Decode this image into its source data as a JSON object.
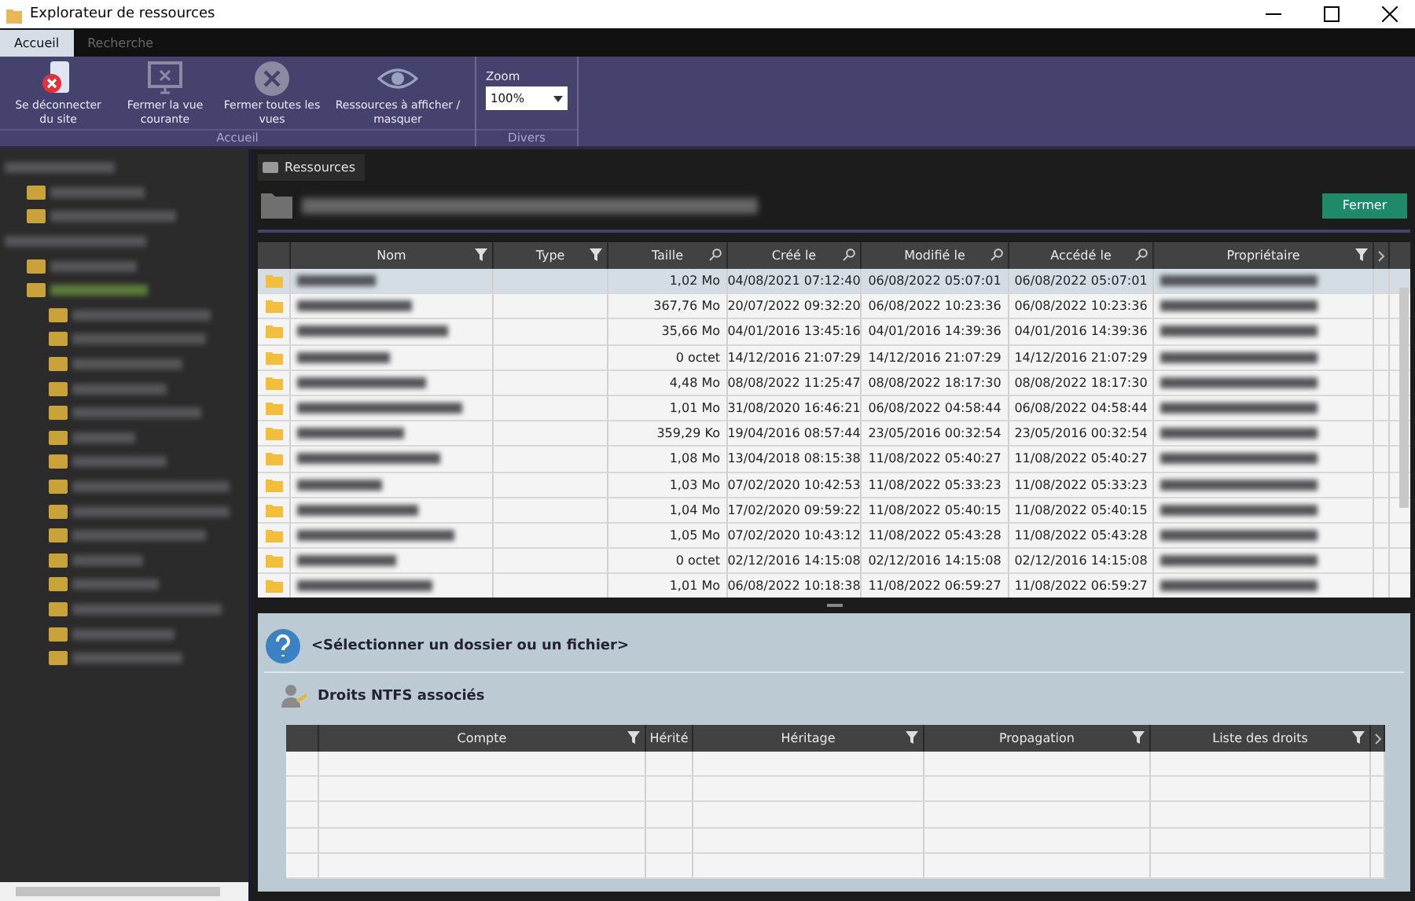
{
  "window": {
    "title": "Explorateur de ressources"
  },
  "ribbon_tabs": [
    {
      "label": "Accueil",
      "selected": true
    },
    {
      "label": "Recherche",
      "selected": false
    }
  ],
  "ribbon_groups": [
    {
      "label": "Accueil",
      "buttons": [
        {
          "kind": "disconnect",
          "label": "Se déconnecter du site"
        },
        {
          "kind": "monitor",
          "label": "Fermer la vue courante"
        },
        {
          "kind": "close-all",
          "label": "Fermer toutes les vues"
        },
        {
          "kind": "eye",
          "label": "Ressources à afficher / masquer"
        }
      ]
    },
    {
      "label": "Divers",
      "zoom": {
        "label": "Zoom",
        "value": "100%"
      }
    }
  ],
  "tree": [
    {
      "selected": false,
      "children": [
        {
          "selected": false
        },
        {
          "selected": false
        }
      ]
    },
    {
      "selected": false,
      "children": [
        {
          "selected": false
        },
        {
          "selected": true,
          "children": [
            {
              "selected": false
            },
            {
              "selected": false
            },
            {
              "selected": false
            },
            {
              "selected": false
            },
            {
              "selected": false
            },
            {
              "selected": false
            },
            {
              "selected": false
            },
            {
              "selected": false
            },
            {
              "selected": false
            },
            {
              "selected": false
            },
            {
              "selected": false
            },
            {
              "selected": false
            },
            {
              "selected": false
            },
            {
              "selected": false
            },
            {
              "selected": false
            }
          ]
        }
      ]
    }
  ],
  "view_tab": {
    "label": "Ressources"
  },
  "close_button": "Fermer",
  "grid": {
    "columns": [
      {
        "label": "Nom",
        "kind": "filter"
      },
      {
        "label": "Type",
        "kind": "filter"
      },
      {
        "label": "Taille",
        "kind": "search"
      },
      {
        "label": "Créé le",
        "kind": "search"
      },
      {
        "label": "Modifié le",
        "kind": "search"
      },
      {
        "label": "Accédé le",
        "kind": "search"
      },
      {
        "label": "Propriétaire",
        "kind": "filter"
      }
    ],
    "rows": [
      {
        "selected": true,
        "size": "1,02 Mo",
        "created": "04/08/2021 07:12:40",
        "modified": "06/08/2022 05:07:01",
        "accessed": "06/08/2022 05:07:01"
      },
      {
        "selected": false,
        "size": "367,76 Mo",
        "created": "20/07/2022 09:32:20",
        "modified": "06/08/2022 10:23:36",
        "accessed": "06/08/2022 10:23:36"
      },
      {
        "selected": false,
        "size": "35,66 Mo",
        "created": "04/01/2016 13:45:16",
        "modified": "04/01/2016 14:39:36",
        "accessed": "04/01/2016 14:39:36"
      },
      {
        "selected": false,
        "size": "0 octet",
        "created": "14/12/2016 21:07:29",
        "modified": "14/12/2016 21:07:29",
        "accessed": "14/12/2016 21:07:29"
      },
      {
        "selected": false,
        "size": "4,48 Mo",
        "created": "08/08/2022 11:25:47",
        "modified": "08/08/2022 18:17:30",
        "accessed": "08/08/2022 18:17:30"
      },
      {
        "selected": false,
        "size": "1,01 Mo",
        "created": "31/08/2020 16:46:21",
        "modified": "06/08/2022 04:58:44",
        "accessed": "06/08/2022 04:58:44"
      },
      {
        "selected": false,
        "size": "359,29 Ko",
        "created": "19/04/2016 08:57:44",
        "modified": "23/05/2016 00:32:54",
        "accessed": "23/05/2016 00:32:54"
      },
      {
        "selected": false,
        "size": "1,08 Mo",
        "created": "13/04/2018 08:15:38",
        "modified": "11/08/2022 05:40:27",
        "accessed": "11/08/2022 05:40:27"
      },
      {
        "selected": false,
        "size": "1,03 Mo",
        "created": "07/02/2020 10:42:53",
        "modified": "11/08/2022 05:33:23",
        "accessed": "11/08/2022 05:33:23"
      },
      {
        "selected": false,
        "size": "1,04 Mo",
        "created": "17/02/2020 09:59:22",
        "modified": "11/08/2022 05:40:15",
        "accessed": "11/08/2022 05:40:15"
      },
      {
        "selected": false,
        "size": "1,05 Mo",
        "created": "07/02/2020 10:43:12",
        "modified": "11/08/2022 05:43:28",
        "accessed": "11/08/2022 05:43:28"
      },
      {
        "selected": false,
        "size": "0 octet",
        "created": "02/12/2016 14:15:08",
        "modified": "02/12/2016 14:15:08",
        "accessed": "02/12/2016 14:15:08"
      },
      {
        "selected": false,
        "size": "1,01 Mo",
        "created": "06/08/2022 10:18:38",
        "modified": "11/08/2022 06:59:27",
        "accessed": "11/08/2022 06:59:27"
      }
    ]
  },
  "details": {
    "prompt": "<Sélectionner un dossier ou un fichier>",
    "rights_title": "Droits NTFS associés",
    "columns": [
      {
        "label": "Compte",
        "kind": "filter"
      },
      {
        "label": "Hérité",
        "kind": "plain"
      },
      {
        "label": "Héritage",
        "kind": "filter"
      },
      {
        "label": "Propagation",
        "kind": "filter"
      },
      {
        "label": "Liste des droits",
        "kind": "filter"
      }
    ]
  }
}
